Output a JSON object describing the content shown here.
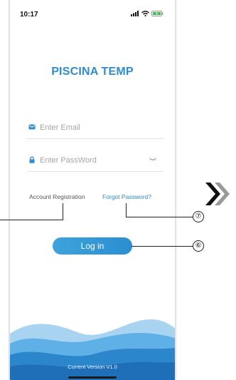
{
  "status_bar": {
    "time": "10:17",
    "signal_icon": "cellular-signal-icon",
    "wifi_icon": "wifi-icon",
    "battery_icon": "battery-charging-icon",
    "battery_color": "#3dbf4a"
  },
  "app": {
    "title": "PISCINA TEMP",
    "accent_color": "#2f8bd4"
  },
  "form": {
    "email": {
      "icon": "mail-icon",
      "placeholder": "Enter Email",
      "value": ""
    },
    "password": {
      "icon": "lock-icon",
      "placeholder": "Enter PassWord",
      "value": "",
      "toggle_icon": "eye-closed-icon"
    }
  },
  "links": {
    "account_registration": "Account Registration",
    "forgot_password": "Forgot Password?"
  },
  "login_button": {
    "label": "Log in"
  },
  "footer": {
    "version": "Current Version V1.0",
    "wave_colors": [
      "#a8d4f2",
      "#5fb0e6",
      "#2c86cc",
      "#1f6fb8"
    ]
  },
  "annotations": {
    "callout_7": "⑦",
    "callout_6": "⑥",
    "next_icon": "double-chevron-right-icon"
  }
}
